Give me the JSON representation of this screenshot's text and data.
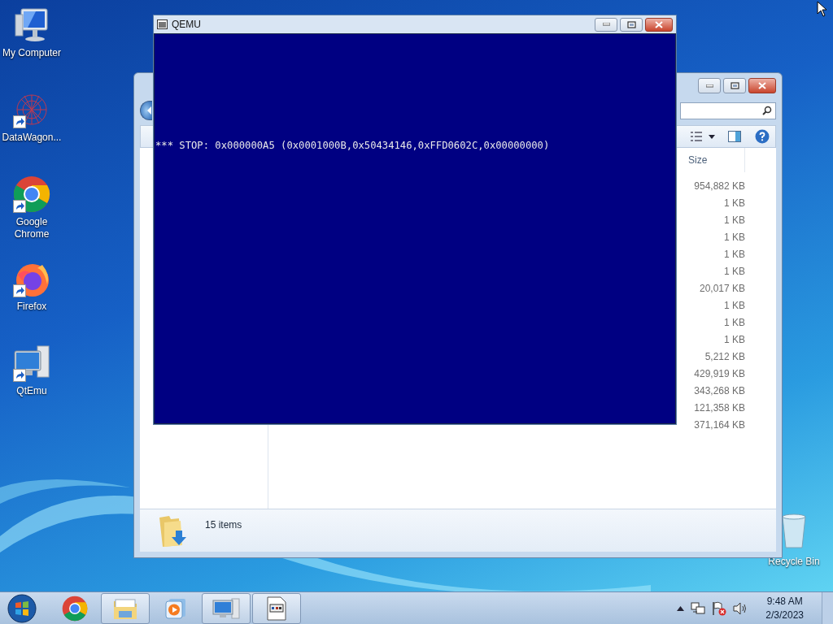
{
  "desktop": {
    "icons": [
      {
        "kind": "computer",
        "label": "My Computer",
        "shortcut": false
      },
      {
        "kind": "network",
        "label": "DataWagon...",
        "shortcut": true
      },
      {
        "kind": "chrome",
        "label": "Google Chrome",
        "shortcut": true
      },
      {
        "kind": "firefox",
        "label": "Firefox",
        "shortcut": true
      },
      {
        "kind": "emulator",
        "label": "QtEmu",
        "shortcut": true
      }
    ],
    "recycle_bin": {
      "label": "Recycle Bin"
    }
  },
  "explorer": {
    "size_column": "Size",
    "sizes": [
      "954,882 KB",
      "1 KB",
      "1 KB",
      "1 KB",
      "1 KB",
      "1 KB",
      "20,017 KB",
      "1 KB",
      "1 KB",
      "1 KB",
      "5,212 KB",
      "429,919 KB",
      "343,268 KB",
      "121,358 KB",
      "371,164 KB"
    ],
    "status": "15 items"
  },
  "qemu": {
    "title": "QEMU",
    "screen_text": "*** STOP: 0x000000A5 (0x0001000B,0x50434146,0xFFD0602C,0x00000000)"
  },
  "taskbar": {
    "items": [
      {
        "kind": "chrome",
        "running": false
      },
      {
        "kind": "explorer",
        "running": true
      },
      {
        "kind": "media",
        "running": false
      },
      {
        "kind": "computer",
        "running": true
      },
      {
        "kind": "document",
        "running": true
      }
    ],
    "clock": {
      "time": "9:48 AM",
      "date": "2/3/2023"
    }
  }
}
